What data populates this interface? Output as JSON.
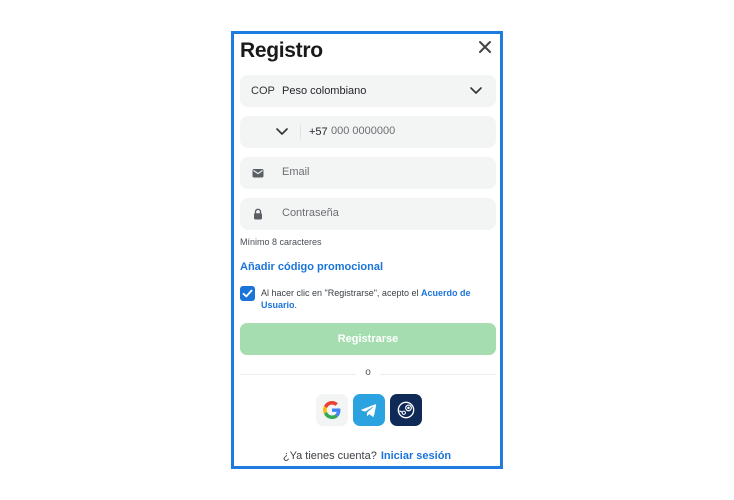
{
  "modal": {
    "title": "Registro"
  },
  "currency": {
    "code": "COP",
    "name": "Peso colombiano"
  },
  "phone": {
    "prefix": "+57",
    "placeholder": "000 0000000"
  },
  "email": {
    "placeholder": "Email"
  },
  "password": {
    "placeholder": "Contraseña",
    "hint": "Mínimo 8 caracteres"
  },
  "promo": {
    "label": "Añadir código promocional"
  },
  "terms": {
    "checked": true,
    "text": "Al hacer clic en \"Registrarse\", acepto el ",
    "link": "Acuerdo de Usuario",
    "suffix": "."
  },
  "submit": {
    "label": "Registrarse"
  },
  "divider": {
    "text": "o"
  },
  "social": {
    "providers": [
      "google",
      "telegram",
      "steam"
    ]
  },
  "login": {
    "question": "¿Ya tienes cuenta?",
    "link": "Iniciar sesión"
  },
  "colors": {
    "accent": "#1b74d9",
    "submit_disabled": "#a5ddb0",
    "modal_border": "#1e7be0",
    "telegram": "#2aa3e0",
    "steam": "#102a57"
  }
}
